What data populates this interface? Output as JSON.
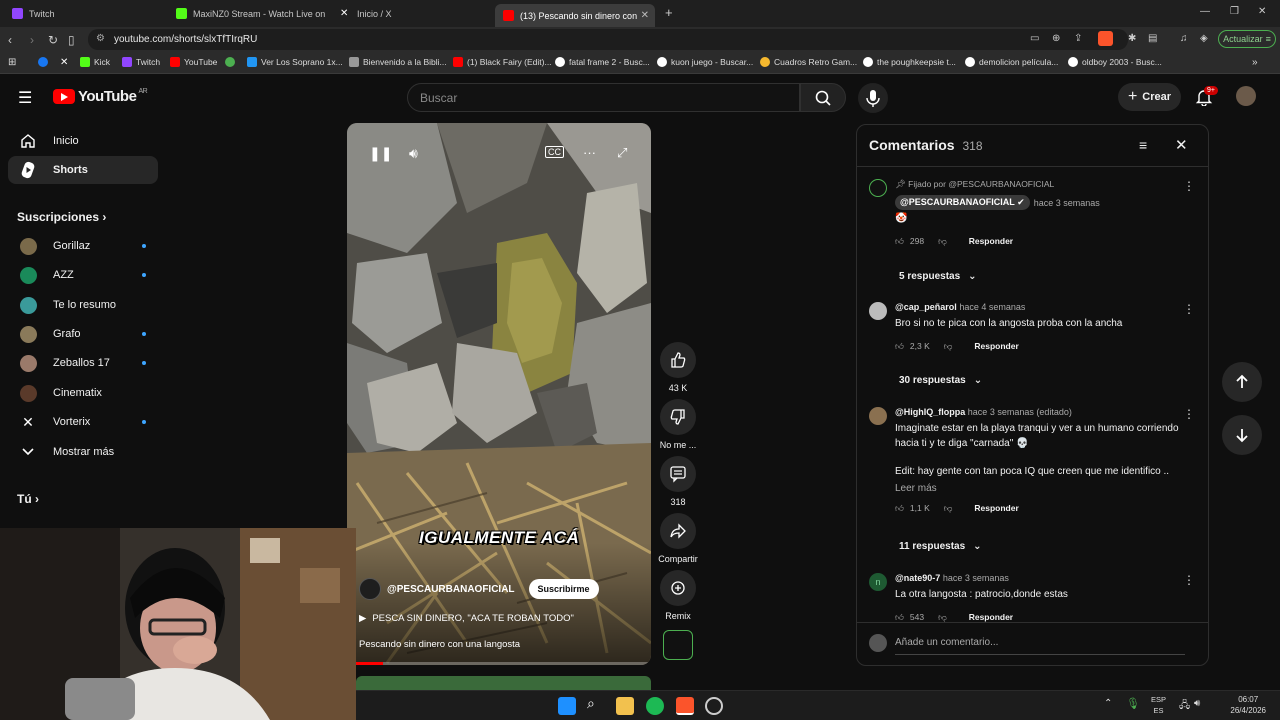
{
  "browser": {
    "tabs": [
      {
        "label": "Twitch",
        "color": "#9146ff"
      },
      {
        "label": "MaxiNZ0 Stream - Watch Live on",
        "color": "#53fc18"
      },
      {
        "label": "Inicio / X",
        "color": "#ffffff"
      },
      {
        "label": "(13) Pescando sin dinero con",
        "color": "#ff0000"
      }
    ],
    "url": "youtube.com/shorts/slxTfTIrqRU",
    "update_label": "Actualizar",
    "bookmarks": [
      "Kick",
      "Twitch",
      "YouTube",
      "",
      "Ver Los Soprano 1x...",
      "Bienvenido a la Bibli...",
      "(1) Black Fairy (Edit)...",
      "fatal frame 2 - Busc...",
      "kuon juego - Buscar...",
      "Cuadros Retro Gam...",
      "the poughkeepsie t...",
      "demolicion película...",
      "oldboy 2003 - Busc..."
    ]
  },
  "yt": {
    "logo_text": "YouTube",
    "region": "AR",
    "search_placeholder": "Buscar",
    "create_label": "Crear",
    "notif_badge": "9+"
  },
  "sidebar": {
    "home": "Inicio",
    "shorts": "Shorts",
    "subs_title": "Suscripciones",
    "subs": [
      {
        "name": "Gorillaz",
        "color": "#7a6a4a",
        "dot": true
      },
      {
        "name": "AZZ",
        "color": "#1a8a5a",
        "dot": true
      },
      {
        "name": "Te lo resumo",
        "color": "#3a9a9a",
        "dot": false
      },
      {
        "name": "Grafo",
        "color": "#8a7a5a",
        "dot": true
      },
      {
        "name": "Zeballos 17",
        "color": "#9a7a6a",
        "dot": true
      },
      {
        "name": "Cinematix",
        "color": "#5a3a2a",
        "dot": false
      },
      {
        "name": "Vorterix",
        "color": "#eeeeee",
        "dot": true
      }
    ],
    "show_more": "Mostrar más",
    "you_title": "Tú"
  },
  "video": {
    "caption": "IGUALMENTE ACÁ",
    "channel": "@PESCAURBANAOFICIAL",
    "subscribe": "Suscribirme",
    "playlist": "PESCA SIN DINERO, \"ACA TE ROBAN TODO\"",
    "title": "Pescando sin dinero con una langosta",
    "progress": 0.12
  },
  "actions": {
    "likes": "43 K",
    "dislike": "No me ...",
    "comments": "318",
    "share": "Compartir",
    "remix": "Remix"
  },
  "comments": {
    "title": "Comentarios",
    "count": "318",
    "items": [
      {
        "pinned": "Fijado por @PESCAURBANAOFICIAL",
        "author": "@PESCAURBANAOFICIAL",
        "time": "hace 3 semanas",
        "text": "🤡",
        "likes": "298",
        "reply": "Responder",
        "replies": "5 respuestas"
      },
      {
        "author": "@cap_peñarol",
        "time": "hace 4 semanas",
        "text": "Bro si no te pica con la angosta proba con la ancha",
        "likes": "2,3 K",
        "reply": "Responder",
        "replies": "30 respuestas"
      },
      {
        "author": "@HighIQ_floppa",
        "time": "hace 3 semanas (editado)",
        "text": "Imaginate estar en la playa tranqui y ver a un humano corriendo hacia ti y te diga \"carnada\" 💀",
        "text2": "Edit: hay gente con tan poca IQ que creen que me identifico ..",
        "read_more": "Leer más",
        "likes": "1,1 K",
        "reply": "Responder",
        "replies": "11 respuestas"
      },
      {
        "author": "@nate90-7",
        "time": "hace 3 semanas",
        "text": "La otra langosta : patrocio,donde estas",
        "likes": "543",
        "reply": "Responder",
        "avatar_letter": "n"
      }
    ],
    "add_placeholder": "Añade un comentario..."
  },
  "taskbar": {
    "lang1": "ESP",
    "lang2": "ES",
    "time": "06:07",
    "date": "26/4/2026"
  }
}
